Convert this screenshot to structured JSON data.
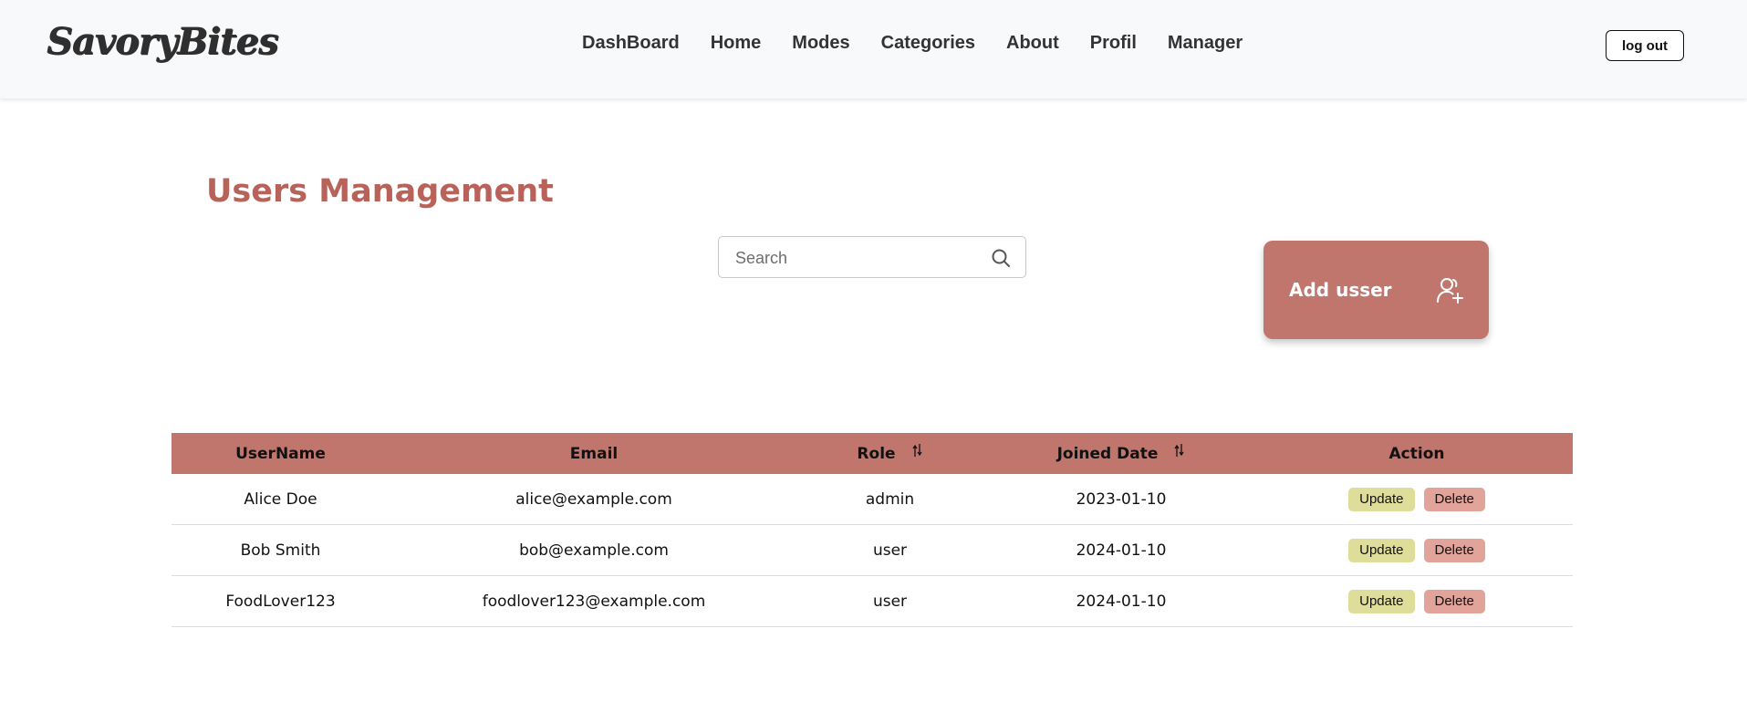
{
  "navbar": {
    "brand": "SavoryBites",
    "links": [
      "DashBoard",
      "Home",
      "Modes",
      "Categories",
      "About",
      "Profil",
      "Manager"
    ],
    "logout_label": "log out"
  },
  "page": {
    "title": "Users Management",
    "search_placeholder": "Search",
    "search_value": "",
    "add_user_label": "Add usser"
  },
  "table": {
    "headers": [
      "UserName",
      "Email",
      "Role",
      "Joined Date",
      "Action"
    ],
    "sortable_columns": [
      "Role",
      "Joined Date"
    ],
    "rows": [
      {
        "username": "Alice Doe",
        "email": "alice@example.com",
        "role": "admin",
        "joined": "2023-01-10"
      },
      {
        "username": "Bob Smith",
        "email": "bob@example.com",
        "role": "user",
        "joined": "2024-01-10"
      },
      {
        "username": "FoodLover123",
        "email": "foodlover123@example.com",
        "role": "user",
        "joined": "2024-01-10"
      }
    ],
    "update_label": "Update",
    "delete_label": "Delete"
  },
  "icons": {
    "search": "search-icon",
    "add_user": "user-plus-icon",
    "sort": "sort-icon"
  },
  "colors": {
    "accent": "#c0766d",
    "title": "#b8625a",
    "update_button": "#dedd9a",
    "delete_button": "#e2a39a",
    "navbar_bg": "#f8f9fa"
  }
}
